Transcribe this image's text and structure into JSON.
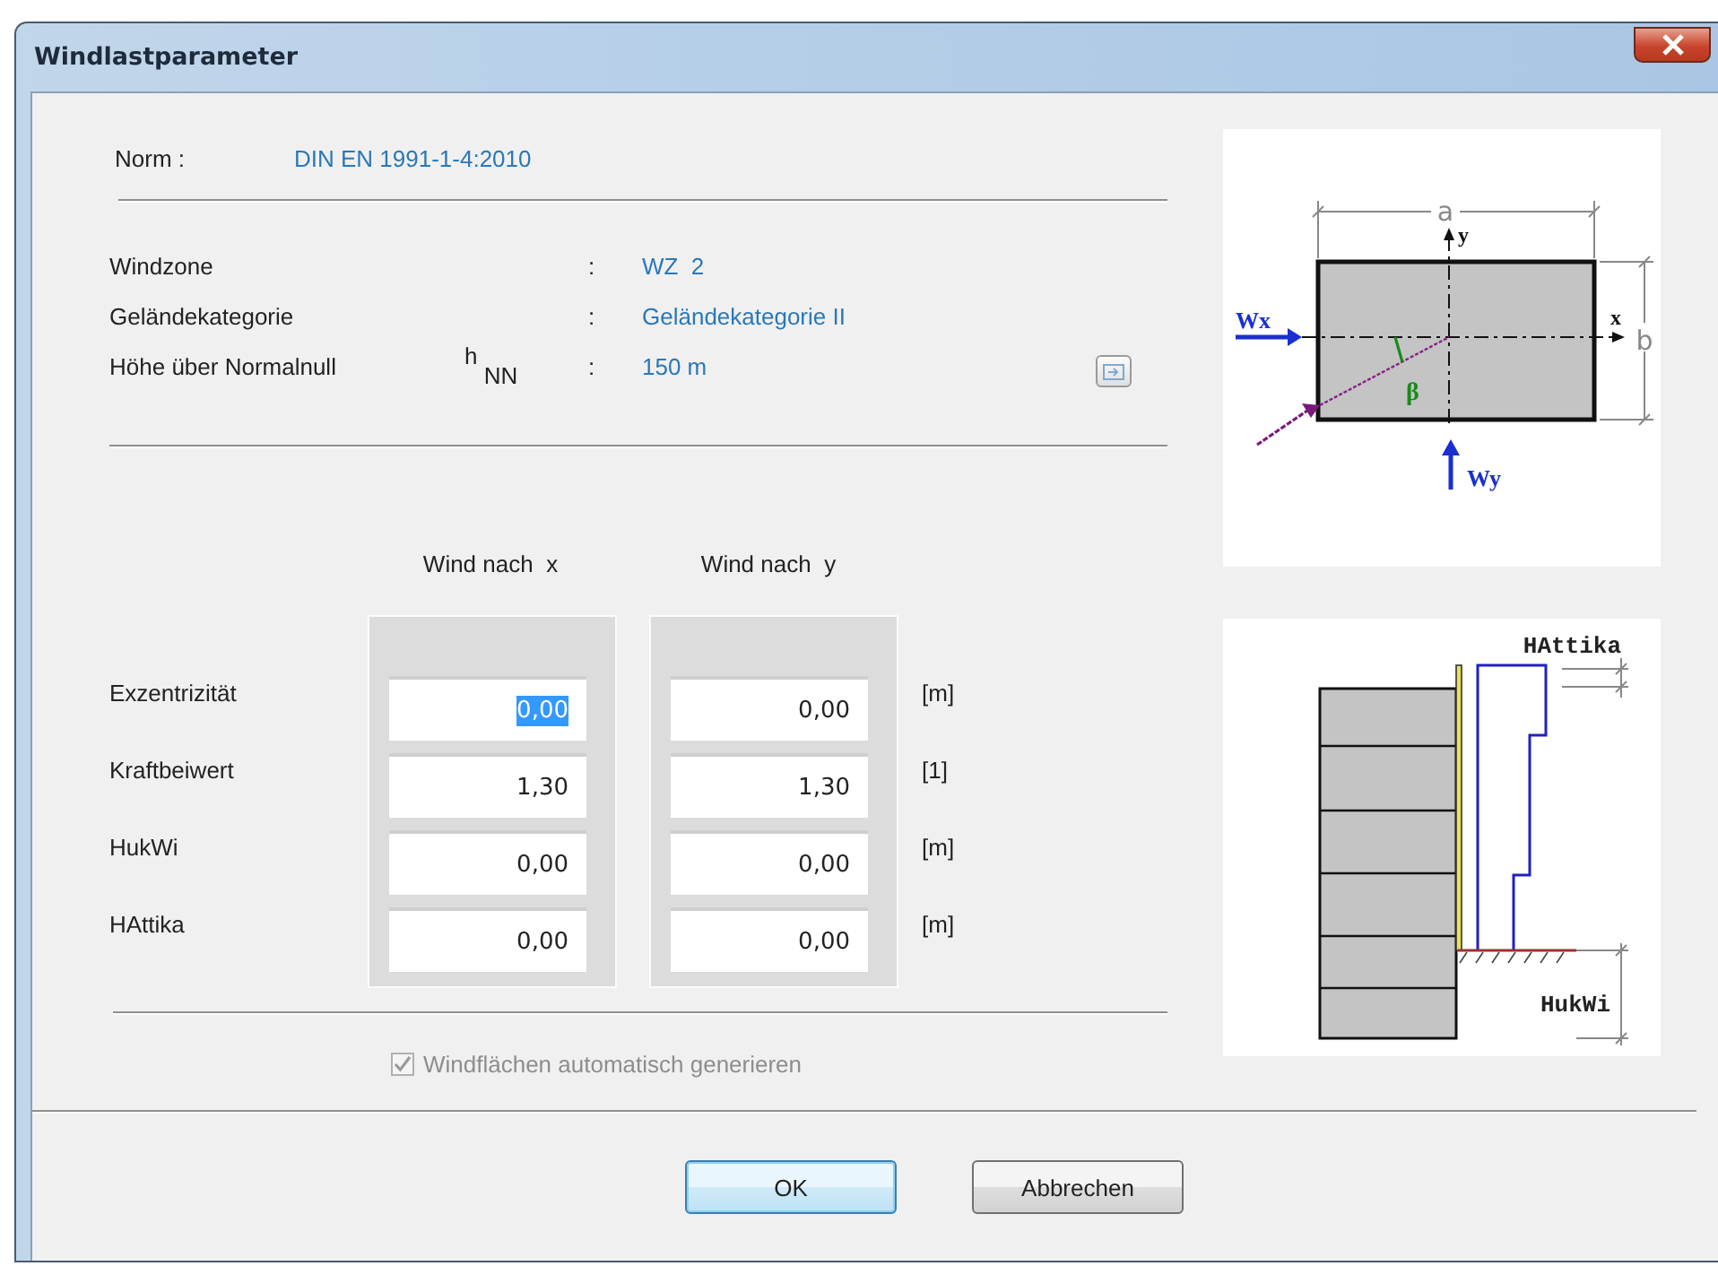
{
  "window": {
    "title": "Windlastparameter"
  },
  "norm": {
    "label": "Norm :",
    "value": "DIN EN 1991-1-4:2010"
  },
  "info": [
    {
      "label": "Windzone",
      "colon": ":",
      "value": "WZ  2"
    },
    {
      "label": "Geländekategorie",
      "colon": ":",
      "value": "Geländekategorie II"
    },
    {
      "label": "Höhe über Normalnull",
      "symbol": "h $_{NN}$",
      "colon": ":",
      "value": "150 m"
    }
  ],
  "columns": [
    "Wind nach  x",
    "Wind nach  y"
  ],
  "rows": [
    {
      "label": "Exzentrizität",
      "unit": "[m]",
      "values": [
        {
          "value": "0,00",
          "text_selected": true
        },
        {
          "value": "0,00",
          "text_selected": false
        }
      ]
    },
    {
      "label": "Kraftbeiwert",
      "unit": "[1]",
      "values": [
        {
          "value": "1,30",
          "text_selected": false
        },
        {
          "value": "1,30",
          "text_selected": false
        }
      ]
    },
    {
      "label": "HukWi",
      "unit": "[m]",
      "values": [
        {
          "value": "0,00",
          "text_selected": false
        },
        {
          "value": "0,00",
          "text_selected": false
        }
      ]
    },
    {
      "label": "HAttika",
      "unit": "[m]",
      "values": [
        {
          "value": "0,00",
          "text_selected": false
        },
        {
          "value": "0,00",
          "text_selected": false
        }
      ]
    }
  ],
  "auto_generate": {
    "label": "Windflächen automatisch generieren",
    "checked": true,
    "disabled": true
  },
  "plan_diagram": {
    "dim_a": "a",
    "axis_y": "y",
    "axis_x": "x",
    "dim_b": "b",
    "wind_x": "Wx",
    "angle": "β",
    "wind_y": "Wy"
  },
  "elevation_diagram": {
    "top_label": "HAttika",
    "bottom_label": "HukWi"
  },
  "buttons": [
    {
      "label": "OK",
      "default": true
    },
    {
      "label": "Abbrechen",
      "default": false
    }
  ]
}
